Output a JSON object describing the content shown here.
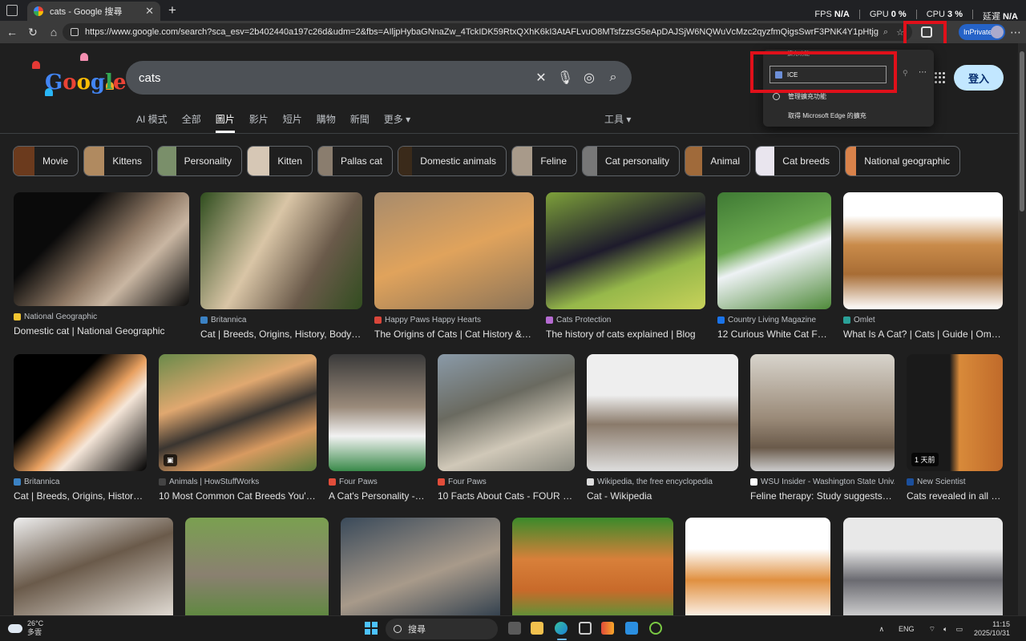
{
  "browser": {
    "tab_title": "cats - Google 搜尋",
    "url": "https://www.google.com/search?sca_esv=2b402440a197c26d&udm=2&fbs=AIljpHybaGNnaZw_4TckIDK59RtxQXhK6kI3AtAFLvuO8MTsfzzsG5eApDAJSjW6NQWuVcMzc2qyzfmQigsSwrF3PNK4Y1pHtjgXpJHLhGLFZokSy1gXHkyxe8cxrzb7uzLtB...",
    "perf": [
      {
        "label": "FPS",
        "value": "N/A"
      },
      {
        "label": "GPU",
        "value": "0 %"
      },
      {
        "label": "CPU",
        "value": "3 %"
      },
      {
        "label": "延遲",
        "value": "N/A"
      }
    ],
    "inprivate_label": "InPrivate"
  },
  "extensions_popup": {
    "header": "擴充功能",
    "extension_name": "ICE",
    "manage_label": "管理擴充功能",
    "get_label": "取得 Microsoft Edge 的擴充"
  },
  "google": {
    "logo_text": "Google",
    "query": "cats",
    "signin_label": "登入",
    "tabs": [
      "AI 模式",
      "全部",
      "圖片",
      "影片",
      "短片",
      "購物",
      "新聞",
      "更多 ▾"
    ],
    "active_tab": "圖片",
    "tools_label": "工具 ▾",
    "chips": [
      "Movie",
      "Kittens",
      "Personality",
      "Kitten",
      "Pallas cat",
      "Domestic animals",
      "Feline",
      "Cat personality",
      "Animal",
      "Cat breeds",
      "National geographic"
    ]
  },
  "results": [
    {
      "source": "National Geographic",
      "title": "Domestic cat | National Geographic"
    },
    {
      "source": "Britannica",
      "title": "Cat | Breeds, Origins, History, Body Ty..."
    },
    {
      "source": "Happy Paws Happy Hearts",
      "title": "The Origins of Cats | Cat History & Fac..."
    },
    {
      "source": "Cats Protection",
      "title": "The history of cats explained | Blog"
    },
    {
      "source": "Country Living Magazine",
      "title": "12 Curious White Cat Fact..."
    },
    {
      "source": "Omlet",
      "title": "What Is A Cat? | Cats | Guide | Omlet US"
    },
    {
      "source": "Britannica",
      "title": "Cat | Breeds, Origins, History, B..."
    },
    {
      "source": "Animals | HowStuffWorks",
      "title": "10 Most Common Cat Breeds You'll Fi..."
    },
    {
      "source": "Four Paws",
      "title": "A Cat's Personality - F..."
    },
    {
      "source": "Four Paws",
      "title": "10 Facts About Cats - FOUR PA..."
    },
    {
      "source": "Wikipedia, the free encyclopedia",
      "title": "Cat - Wikipedia"
    },
    {
      "source": "WSU Insider - Washington State Univ...",
      "title": "Feline therapy: Study suggests cat..."
    },
    {
      "source": "New Scientist",
      "title": "Cats revealed in all th..."
    }
  ],
  "badge_1day": "1 天前",
  "taskbar": {
    "temp": "26°C",
    "weather": "多雲",
    "search_label": "搜尋",
    "lang": "ENG",
    "time": "11:15",
    "date": "2025/10/31"
  }
}
